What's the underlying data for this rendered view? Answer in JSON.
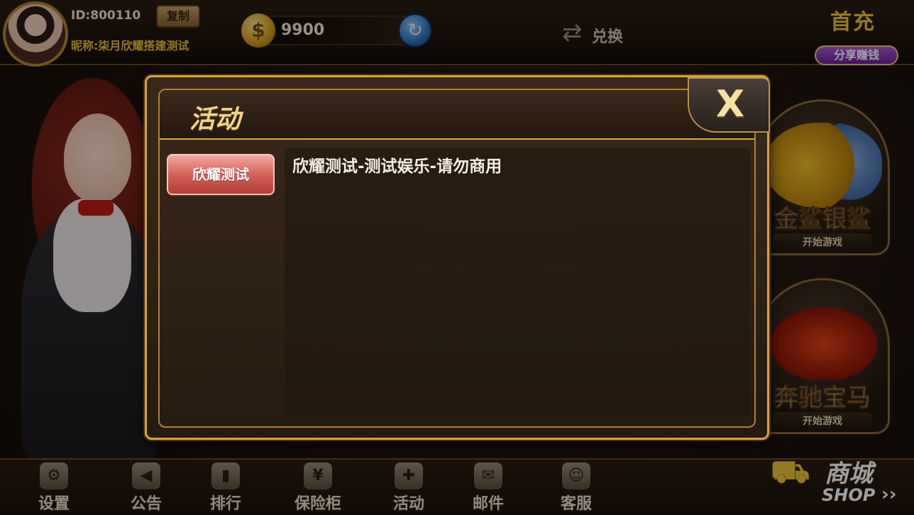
{
  "user": {
    "id": "ID:800110",
    "copy_label": "复制",
    "nickname": "昵称:柒月欣耀搭建测试",
    "coins": "9900"
  },
  "header": {
    "exchange_label": "兑换",
    "share_top": "首充",
    "share_label": "分享赚钱"
  },
  "games": [
    {
      "title": "金鲨银鲨",
      "play_label": "开始游戏"
    },
    {
      "title": "奔驰宝马",
      "play_label": "开始游戏"
    }
  ],
  "dialog": {
    "title": "活动",
    "close_label": "X",
    "tab": "欣耀测试",
    "content": "欣耀测试-测试娱乐-请勿商用"
  },
  "bottom_nav": [
    {
      "label": "设置",
      "icon": "gear-icon"
    },
    {
      "label": "公告",
      "icon": "megaphone-icon"
    },
    {
      "label": "排行",
      "icon": "ranking-icon"
    },
    {
      "label": "保险柜",
      "icon": "safe-icon"
    },
    {
      "label": "活动",
      "icon": "gift-icon"
    },
    {
      "label": "邮件",
      "icon": "mail-icon"
    },
    {
      "label": "客服",
      "icon": "support-icon"
    }
  ],
  "shop": {
    "label": "商城",
    "en_label": "SHOP"
  }
}
